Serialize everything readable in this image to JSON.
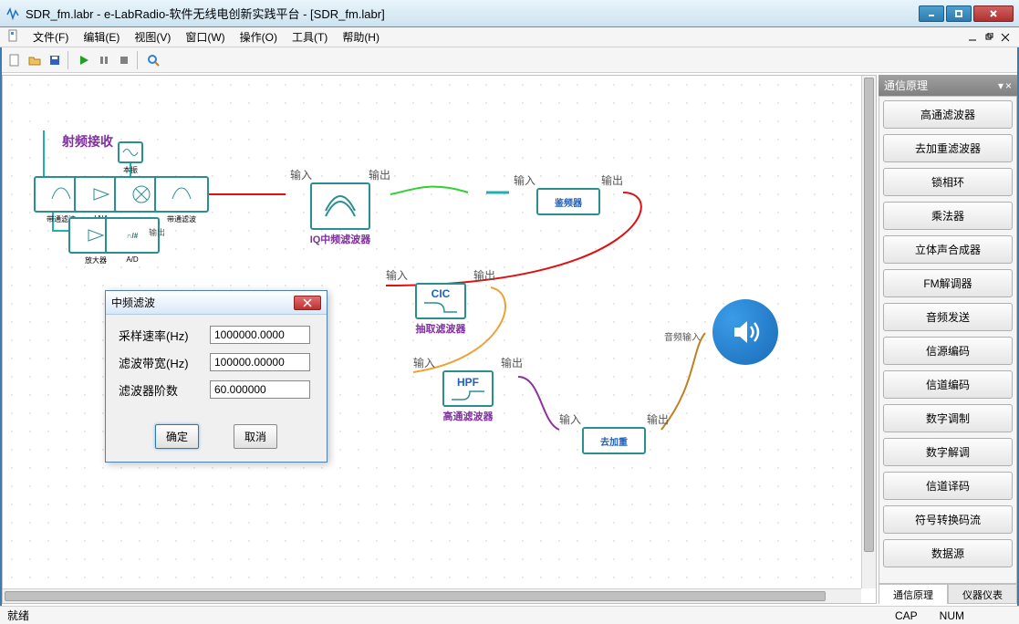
{
  "title": "SDR_fm.labr - e-LabRadio-软件无线电创新实践平台 - [SDR_fm.labr]",
  "menu": {
    "file": "文件(F)",
    "edit": "编辑(E)",
    "view": "视图(V)",
    "window": "窗口(W)",
    "operate": "操作(O)",
    "tool": "工具(T)",
    "help": "帮助(H)"
  },
  "sidepanel": {
    "title": "通信原理",
    "items": [
      "高通滤波器",
      "去加重滤波器",
      "锁相环",
      "乘法器",
      "立体声合成器",
      "FM解调器",
      "音频发送",
      "信源编码",
      "信道编码",
      "数字调制",
      "数字解调",
      "信道译码",
      "符号转换码流",
      "数据源"
    ],
    "tabs": {
      "a": "通信原理",
      "b": "仪器仪表"
    }
  },
  "dialog": {
    "title": "中频滤波",
    "row1_label": "采样速率(Hz)",
    "row1_val": "1000000.0000",
    "row2_label": "滤波带宽(Hz)",
    "row2_val": "100000.00000",
    "row3_label": "滤波器阶数",
    "row3_val": "60.000000",
    "ok": "确定",
    "cancel": "取消"
  },
  "nodes": {
    "rf_label": "射频接收",
    "iq_label": "IQ中频滤波器",
    "iq_in": "输入",
    "iq_out": "输出",
    "disc_label": "鉴频器",
    "disc_in": "输入",
    "disc_out": "输出",
    "cic_label": "抽取滤波器",
    "cic_box": "CIC",
    "cic_in": "输入",
    "cic_out": "输出",
    "hpf_label": "高通滤波器",
    "hpf_box": "HPF",
    "hpf_in": "输入",
    "hpf_out": "输出",
    "deemph_label": "去加重",
    "deemph_in": "输入",
    "deemph_out": "输出",
    "audio_in": "音频输入",
    "rf_bpf": "带通滤波",
    "rf_lna": "LNA",
    "rf_bpf2": "带通滤波",
    "rf_lo": "本振",
    "rf_amp": "放大器",
    "rf_ad": "A/D",
    "rf_out": "输出"
  },
  "status": {
    "ready": "就绪",
    "cap": "CAP",
    "num": "NUM"
  }
}
